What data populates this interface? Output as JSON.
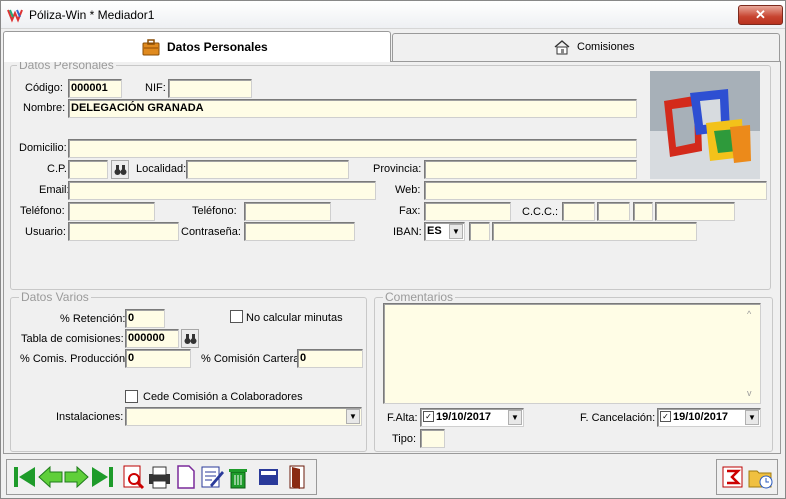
{
  "window": {
    "title": "Póliza-Win * Mediador1",
    "close_label": "✕"
  },
  "tabs": [
    {
      "label": "Datos Personales",
      "active": true
    },
    {
      "label": "Comisiones",
      "active": false
    }
  ],
  "personal": {
    "group_title": "Datos Personales",
    "codigo_label": "Código:",
    "codigo_value": "000001",
    "nif_label": "NIF:",
    "nif_value": "",
    "nombre_label": "Nombre:",
    "nombre_value": "DELEGACIÓN GRANADA",
    "domicilio_label": "Domicilio:",
    "domicilio_value": "",
    "cp_label": "C.P.:",
    "cp_value": "",
    "localidad_label": "Localidad:",
    "localidad_value": "",
    "provincia_label": "Provincia:",
    "provincia_value": "",
    "email_label": "Email:",
    "email_value": "",
    "web_label": "Web:",
    "web_value": "",
    "telefono1_label": "Teléfono:",
    "telefono1_value": "",
    "telefono2_label": "Teléfono:",
    "telefono2_value": "",
    "fax_label": "Fax:",
    "fax_value": "",
    "ccc_label": "C.C.C.:",
    "usuario_label": "Usuario:",
    "usuario_value": "",
    "contrasena_label": "Contraseña:",
    "contrasena_value": "",
    "iban_label": "IBAN:",
    "iban_country": "ES"
  },
  "varios": {
    "group_title": "Datos Varios",
    "retencion_label": "% Retención:",
    "retencion_value": "0",
    "no_calcular_label": "No calcular minutas",
    "tabla_label": "Tabla de comisiones:",
    "tabla_value": "000000",
    "comis_prod_label": "% Comis. Producción:",
    "comis_prod_value": "0",
    "comis_cartera_label": "% Comisión Cartera:",
    "comis_cartera_value": "0",
    "cede_label": "Cede Comisión a Colaboradores",
    "instalaciones_label": "Instalaciones:",
    "instalaciones_value": ""
  },
  "comentarios": {
    "group_title": "Comentarios",
    "falta_label": "F.Alta:",
    "falta_value": "19/10/2017",
    "fcancel_label": "F. Cancelación:",
    "fcancel_value": "19/10/2017",
    "tipo_label": "Tipo:",
    "tipo_value": ""
  },
  "colors": {
    "field_bg": "#fffde6",
    "nav_green": "#1e9b2a",
    "close_red": "#c7432f"
  }
}
